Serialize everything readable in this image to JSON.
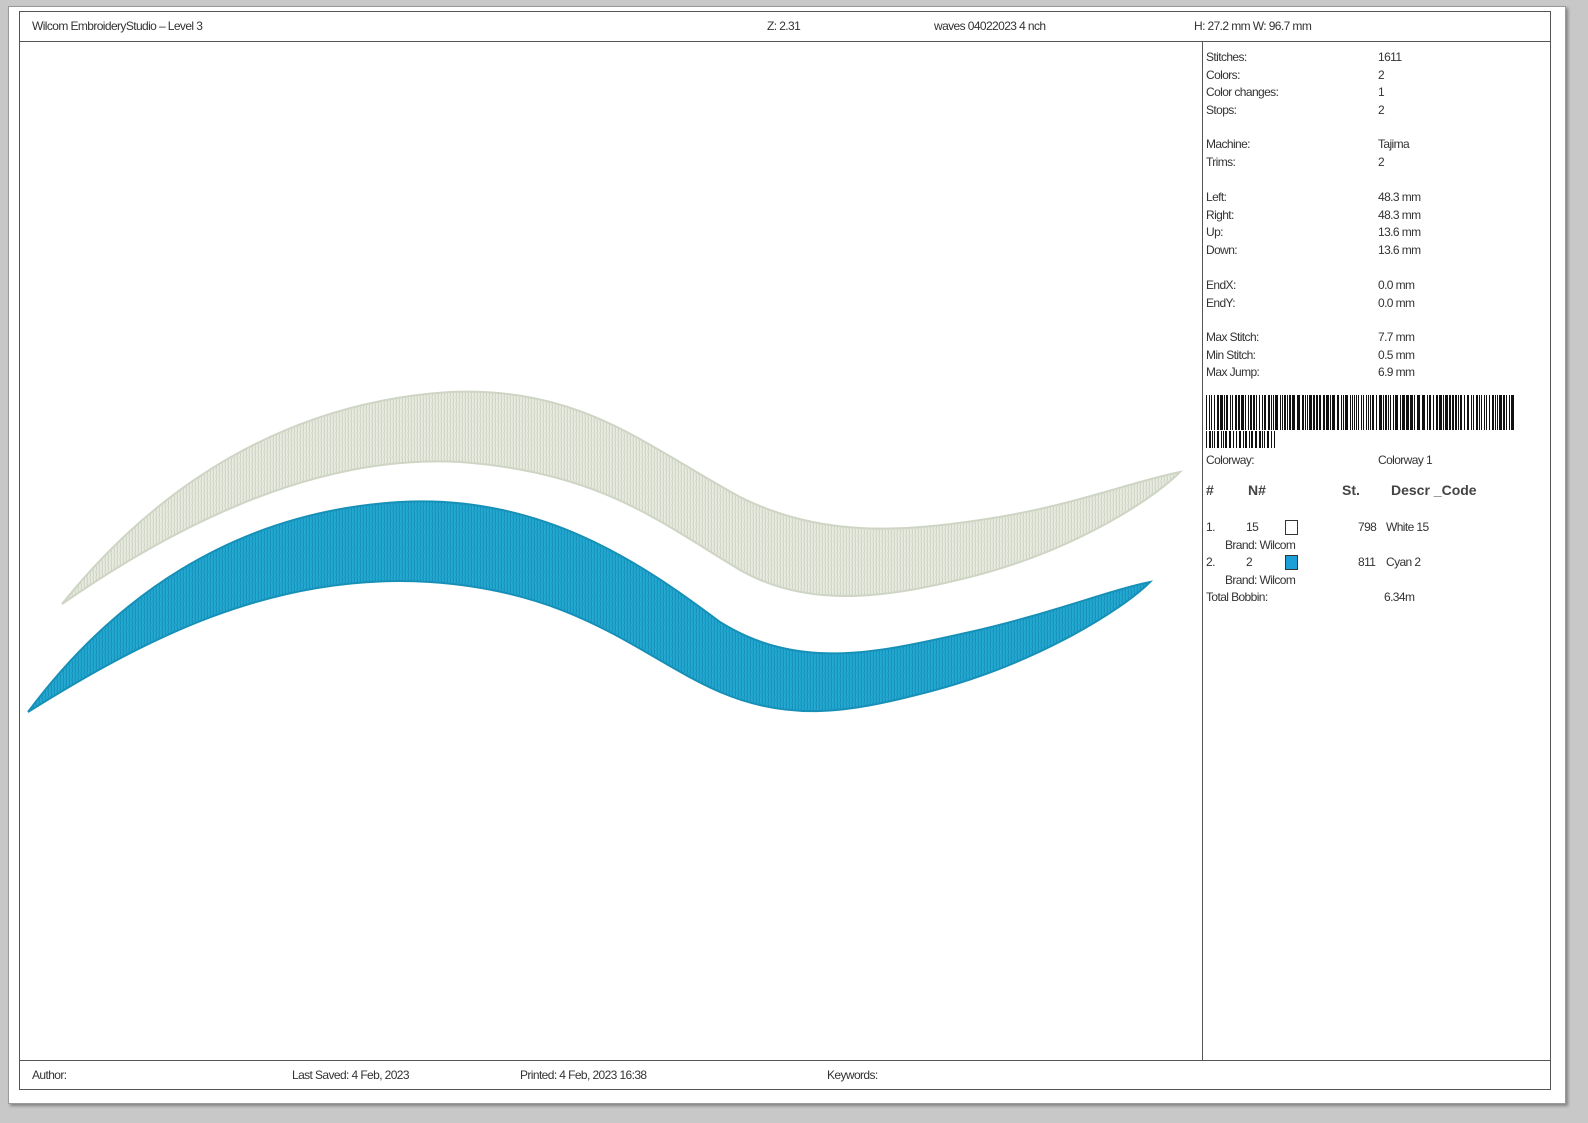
{
  "header": {
    "app_title": "Wilcom EmbroideryStudio – Level 3",
    "zoom": "Z: 2.31",
    "design_name": "waves 04022023 4 nch",
    "size": "H: 27.2 mm   W: 96.7 mm"
  },
  "stats": [
    {
      "label": "Stitches:",
      "value": "1611"
    },
    {
      "label": "Colors:",
      "value": "2"
    },
    {
      "label": "Color changes:",
      "value": "1"
    },
    {
      "label": "Stops:",
      "value": "2"
    },
    {
      "label": "Machine:",
      "value": "Tajima"
    },
    {
      "label": "Trims:",
      "value": "2"
    },
    {
      "label": "Left:",
      "value": "48.3 mm"
    },
    {
      "label": "Right:",
      "value": "48.3 mm"
    },
    {
      "label": "Up:",
      "value": "13.6 mm"
    },
    {
      "label": "Down:",
      "value": "13.6 mm"
    },
    {
      "label": "EndX:",
      "value": "0.0 mm"
    },
    {
      "label": "EndY:",
      "value": "0.0 mm"
    },
    {
      "label": "Max Stitch:",
      "value": "7.7 mm"
    },
    {
      "label": "Min Stitch:",
      "value": "0.5 mm"
    },
    {
      "label": "Max Jump:",
      "value": "6.9 mm"
    }
  ],
  "colorway": {
    "label": "Colorway:",
    "value": "Colorway 1"
  },
  "color_table": {
    "headers": {
      "num": "#",
      "n": "N#",
      "st": "St.",
      "descr": "Descr _Code"
    },
    "rows": [
      {
        "num": "1.",
        "n": "15",
        "st": "798",
        "descr": "White 15",
        "brand": "Brand: Wilcom",
        "color": "#ffffff"
      },
      {
        "num": "2.",
        "n": "2",
        "st": "811",
        "descr": "Cyan 2",
        "brand": "Brand: Wilcom",
        "color": "#1a9fd8"
      }
    ],
    "total_label": "Total Bobbin:",
    "total_value": "6.34m"
  },
  "footer": {
    "author": "Author:",
    "last_saved": "Last Saved:  4 Feb, 2023",
    "printed": "Printed:  4 Feb, 2023 16:38",
    "keywords": "Keywords:"
  },
  "design_colors": {
    "white_thread": "#e4e8dc",
    "cyan_thread": "#1fa6cf"
  }
}
